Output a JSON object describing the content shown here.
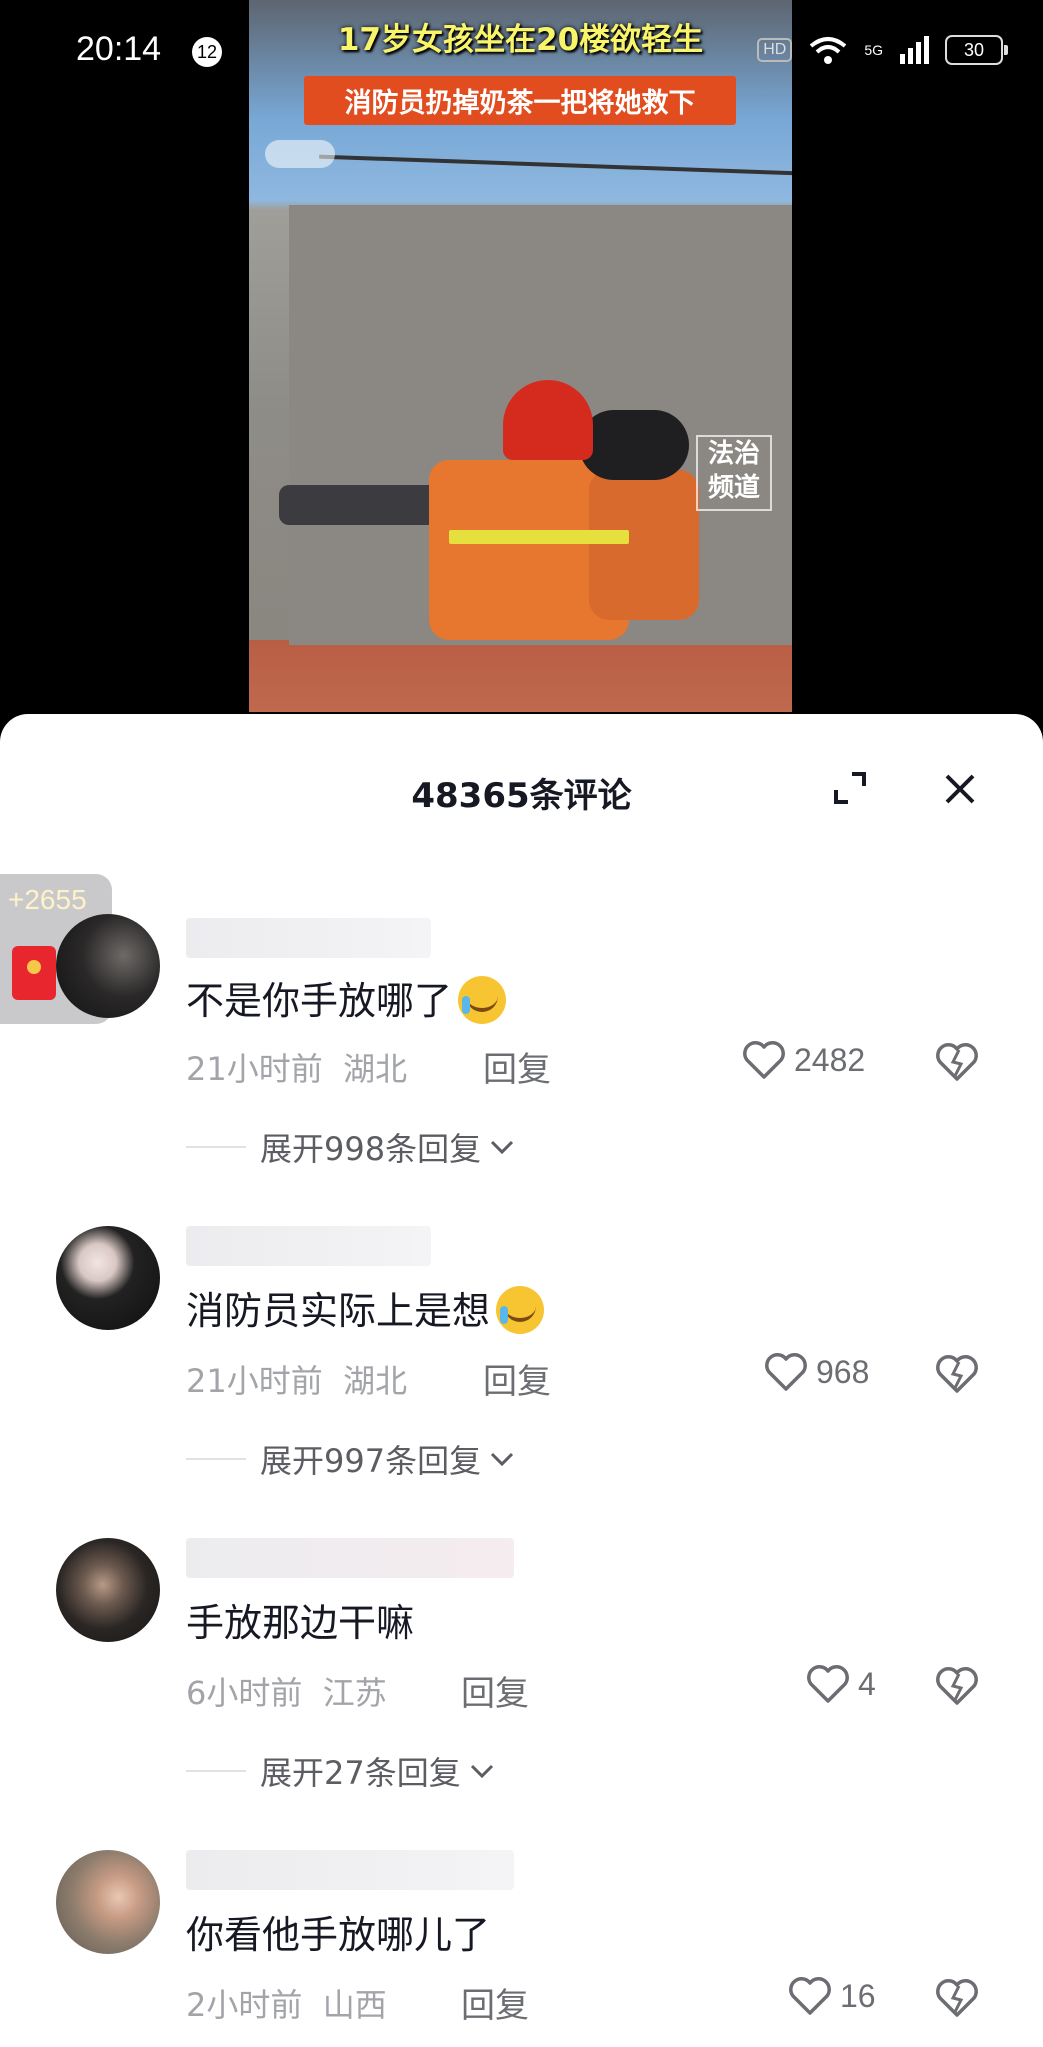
{
  "status_bar": {
    "time": "20:14",
    "notification_count": "12",
    "hd_label": "HD",
    "network": "5G",
    "battery": "30"
  },
  "video": {
    "caption_line1": "17岁女孩坐在20楼欲轻生",
    "caption_line2": "消防员扔掉奶茶一把将她救下",
    "watermark": "法治频道"
  },
  "comments_panel": {
    "title": "48365条评论",
    "reward_count": "+2655",
    "comments": [
      {
        "text": "不是你手放哪了",
        "emoji": "crying-laughing-emoji",
        "time": "21小时前",
        "location": "湖北",
        "reply_label": "回复",
        "likes": "2482",
        "expand_label": "展开998条回复"
      },
      {
        "text": "消防员实际上是想",
        "emoji": "crying-laughing-emoji",
        "time": "21小时前",
        "location": "湖北",
        "reply_label": "回复",
        "likes": "968",
        "expand_label": "展开997条回复"
      },
      {
        "text": "手放那边干嘛",
        "time": "6小时前",
        "location": "江苏",
        "reply_label": "回复",
        "likes": "4",
        "expand_label": "展开27条回复"
      },
      {
        "text": "你看他手放哪儿了",
        "time": "2小时前",
        "location": "山西",
        "reply_label": "回复",
        "likes": "16"
      }
    ]
  },
  "colors": {
    "panel_bg": "#ffffff",
    "text_primary": "#161823",
    "text_secondary": "#a3a4a9",
    "caption_yellow": "#f9f46a",
    "caption_red": "#e14d1e"
  }
}
